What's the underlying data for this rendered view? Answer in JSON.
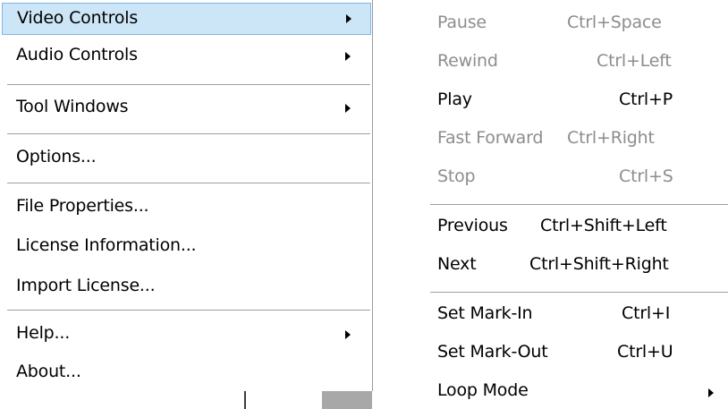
{
  "main_menu": {
    "items": [
      {
        "label": "Video Controls",
        "submenu": true,
        "highlighted": true
      },
      {
        "label": "Audio Controls",
        "submenu": true
      },
      {
        "label": "Tool Windows",
        "submenu": true
      },
      {
        "label": "Options..."
      },
      {
        "label": "File Properties..."
      },
      {
        "label": "License Information..."
      },
      {
        "label": "Import License..."
      },
      {
        "label": "Help...",
        "submenu": true
      },
      {
        "label": "About..."
      }
    ]
  },
  "video_submenu": {
    "items": [
      {
        "label": "Pause",
        "shortcut": "Ctrl+Space",
        "enabled": false
      },
      {
        "label": "Rewind",
        "shortcut": "Ctrl+Left",
        "enabled": false
      },
      {
        "label": "Play",
        "shortcut": "Ctrl+P",
        "enabled": true
      },
      {
        "label": "Fast Forward",
        "shortcut": "Ctrl+Right",
        "enabled": false
      },
      {
        "label": "Stop",
        "shortcut": "Ctrl+S",
        "enabled": false
      },
      {
        "label": "Previous",
        "shortcut": "Ctrl+Shift+Left",
        "enabled": true
      },
      {
        "label": "Next",
        "shortcut": "Ctrl+Shift+Right",
        "enabled": true
      },
      {
        "label": "Set Mark-In",
        "shortcut": "Ctrl+I",
        "enabled": true
      },
      {
        "label": "Set Mark-Out",
        "shortcut": "Ctrl+U",
        "enabled": true
      },
      {
        "label": "Loop Mode",
        "shortcut": "",
        "enabled": true,
        "submenu": true
      }
    ]
  },
  "colors": {
    "highlight_bg": "#cde6f7",
    "highlight_border": "#7fb7e6",
    "disabled_text": "#8d8d8d",
    "separator": "#a0a0a0"
  }
}
